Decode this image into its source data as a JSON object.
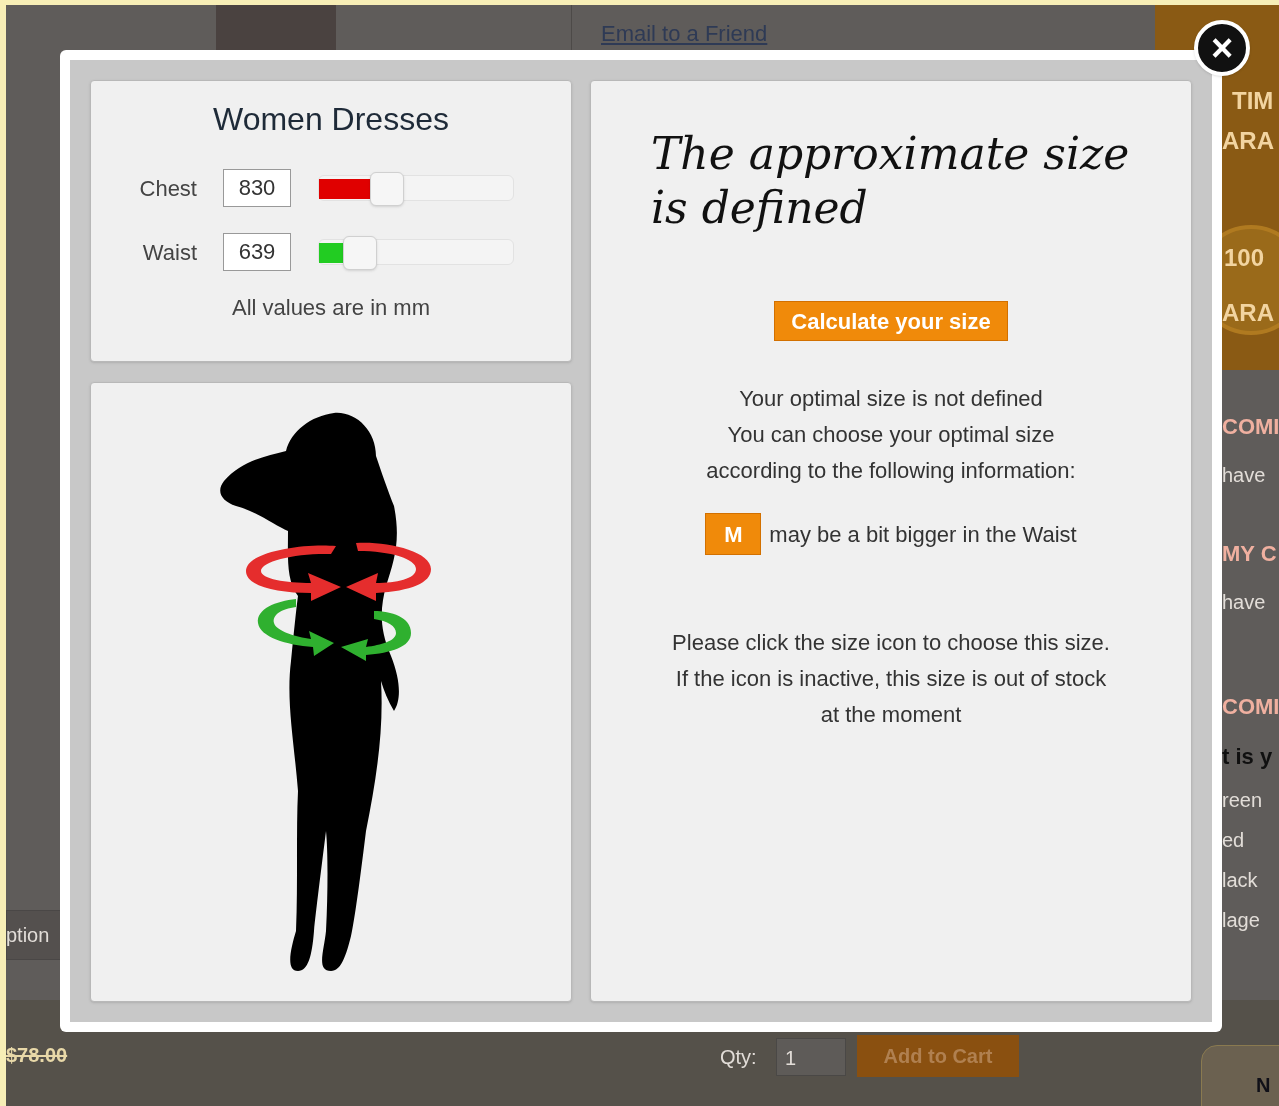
{
  "background_page": {
    "email_link": "Email to a Friend",
    "tab_fragment": "ption",
    "old_price": "$78.00",
    "qty_label": "Qty:",
    "qty_value": "1",
    "add_to_cart": "Add to Cart",
    "badge_texts": [
      "TIM",
      "ARA",
      "100",
      "ARA"
    ],
    "sidebar_texts": [
      {
        "kind": "heading",
        "text": "COMI"
      },
      {
        "kind": "line",
        "text": "have"
      },
      {
        "kind": "heading",
        "text": "MY C"
      },
      {
        "kind": "line",
        "text": "have"
      },
      {
        "kind": "heading",
        "text": "COMI"
      },
      {
        "kind": "bold",
        "text": "t is y"
      },
      {
        "kind": "line",
        "text": "reen"
      },
      {
        "kind": "line",
        "text": "ed"
      },
      {
        "kind": "line",
        "text": "lack"
      },
      {
        "kind": "line",
        "text": "lage"
      }
    ],
    "corner_text": "N"
  },
  "modal": {
    "close": "×",
    "measure_panel": {
      "title": "Women Dresses",
      "channels": [
        {
          "name": "Chest",
          "value": "830",
          "level": 0.26,
          "color": "#e00000"
        },
        {
          "name": "Waist",
          "value": "639",
          "level": 0.12,
          "color": "#22cc22"
        }
      ],
      "note": "All values are in mm"
    },
    "result_panel": {
      "heading": "The approximate size is defined",
      "button": "Calculate your size",
      "info_lines": [
        "Your optimal size is not defined",
        "You can choose your optimal size",
        "according to the following information:"
      ],
      "suggestion": {
        "size": "M",
        "text": "may be a bit bigger in the Waist"
      },
      "help_lines": [
        "Please click the size icon to choose this size.",
        "If the icon is inactive, this size is out of stock",
        "at the moment"
      ]
    }
  }
}
